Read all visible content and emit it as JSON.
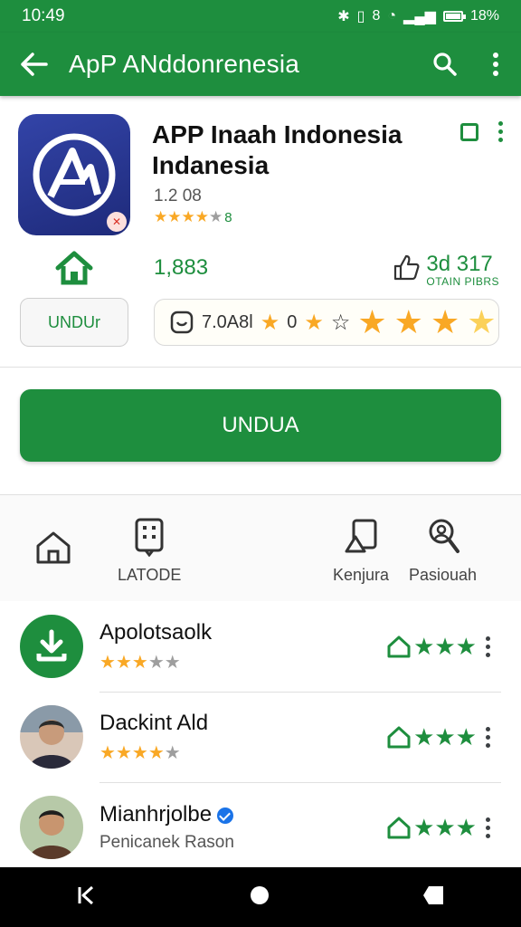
{
  "status_bar": {
    "time": "10:49",
    "signal_text": "8",
    "battery": "18%"
  },
  "app_bar": {
    "title": "ApP ANddonrenesia"
  },
  "app": {
    "name": "APP Inaah Indonesia Indanesia",
    "meta": "1.2 08",
    "rating_label": "8",
    "stars": 4,
    "downloads": "1,883",
    "reviews_count": "3d 317",
    "reviews_sub": "OTAIN PIBRS",
    "small_button": "UNDUr",
    "rating_box_text": "7.0A8l",
    "rating_box_zero": "0"
  },
  "install_button": "UNDUA",
  "nav": [
    {
      "label": "",
      "icon": "home-icon"
    },
    {
      "label": "LATODE",
      "icon": "apps-grid-icon"
    },
    {
      "label": "Kenjura",
      "icon": "share-icon"
    },
    {
      "label": "Pasiouah",
      "icon": "search-person-icon"
    }
  ],
  "list": [
    {
      "title": "Apolotsaolk",
      "subtitle": "",
      "stars": 3,
      "avatar": "download-icon"
    },
    {
      "title": "Dackint Ald",
      "subtitle": "",
      "stars": 4,
      "avatar": "person-avatar"
    },
    {
      "title": "Mianhrjolbe",
      "subtitle": "Penicanek Rason",
      "stars": 0,
      "avatar": "person-avatar",
      "verified": true
    }
  ],
  "colors": {
    "primary": "#1e8e3e",
    "star": "#f9a825",
    "icon_bg": "#2a3590"
  }
}
